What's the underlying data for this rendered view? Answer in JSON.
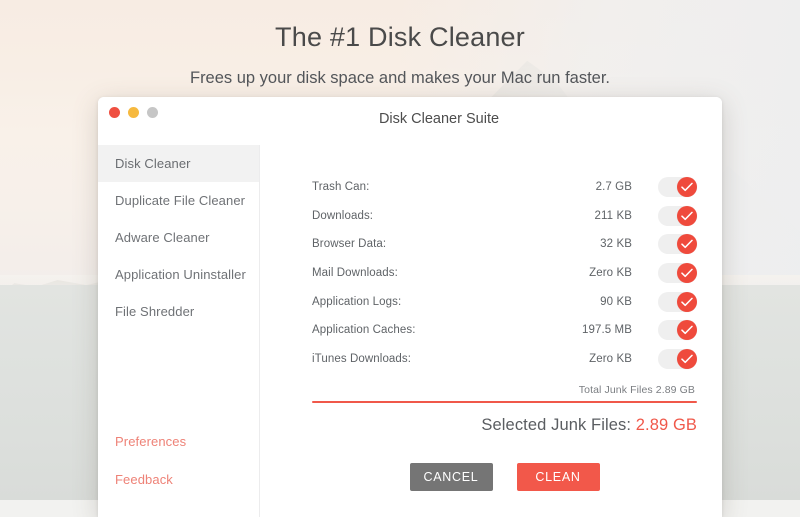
{
  "hero": {
    "title": "The #1 Disk Cleaner",
    "subtitle": "Frees up your disk space and makes your Mac run faster."
  },
  "window": {
    "title": "Disk Cleaner Suite",
    "traffic_lights": {
      "close": "close-button",
      "minimize": "minimize-button",
      "zoom": "zoom-button"
    }
  },
  "sidebar": {
    "items": [
      {
        "label": "Disk Cleaner",
        "active": true
      },
      {
        "label": "Duplicate File Cleaner",
        "active": false
      },
      {
        "label": "Adware Cleaner",
        "active": false
      },
      {
        "label": "Application Uninstaller",
        "active": false
      },
      {
        "label": "File Shredder",
        "active": false
      }
    ],
    "links": [
      {
        "label": "Preferences"
      },
      {
        "label": "Feedback"
      }
    ]
  },
  "main": {
    "rows": [
      {
        "label": "Trash Can:",
        "size": "2.7 GB",
        "enabled": true
      },
      {
        "label": "Downloads:",
        "size": "211 KB",
        "enabled": true
      },
      {
        "label": "Browser Data:",
        "size": "32 KB",
        "enabled": true
      },
      {
        "label": "Mail Downloads:",
        "size": "Zero KB",
        "enabled": true
      },
      {
        "label": "Application Logs:",
        "size": "90 KB",
        "enabled": true
      },
      {
        "label": "Application Caches:",
        "size": "197.5 MB",
        "enabled": true
      },
      {
        "label": "iTunes Downloads:",
        "size": "Zero KB",
        "enabled": true
      }
    ],
    "total_line": "Total Junk Files 2.89 GB",
    "selected_label": "Selected Junk Files:",
    "selected_value": "2.89 GB",
    "buttons": {
      "cancel": "CANCEL",
      "clean": "CLEAN"
    }
  },
  "colors": {
    "accent_red": "#f2584a",
    "toggle_on": "#ef4a3c",
    "link_red": "#ee8277",
    "cancel_gray": "#757575",
    "rule_red": "#f0584a"
  },
  "icons": {
    "toggle_check": "check-icon"
  }
}
